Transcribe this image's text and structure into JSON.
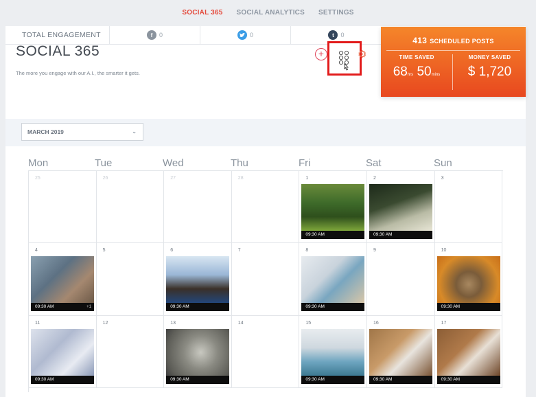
{
  "nav": {
    "items": [
      "SOCIAL 365",
      "SOCIAL ANALYTICS",
      "SETTINGS"
    ],
    "active": 0
  },
  "engagement": {
    "label": "TOTAL ENGAGEMENT",
    "facebook": "0",
    "twitter": "0",
    "tumblr": "0"
  },
  "header": {
    "title": "SOCIAL 365",
    "subtitle": "The more you engage with our A.I., the smarter it gets."
  },
  "stats": {
    "scheduled_count": "413",
    "scheduled_label": "SCHEDULED POSTS",
    "time_label": "TIME SAVED",
    "time_hrs": "68",
    "time_hrs_unit": "hrs",
    "time_mins": "50",
    "time_mins_unit": "mins",
    "money_label": "MONEY SAVED",
    "money_value": "$ 1,720"
  },
  "month_select": {
    "value": "MARCH 2019"
  },
  "calendar": {
    "weekdays": [
      "Mon",
      "Tue",
      "Wed",
      "Thu",
      "Fri",
      "Sat",
      "Sun"
    ],
    "weeks": [
      [
        {
          "day": "25",
          "other": true
        },
        {
          "day": "26",
          "other": true
        },
        {
          "day": "27",
          "other": true
        },
        {
          "day": "28",
          "other": true
        },
        {
          "day": "1",
          "time": "09:30 AM",
          "img": "forest"
        },
        {
          "day": "2",
          "time": "09:30 AM",
          "img": "grass"
        },
        {
          "day": "3"
        }
      ],
      [
        {
          "day": "4",
          "time": "09:30 AM",
          "img": "couple-bench",
          "extra": "+1",
          "strip": "orange"
        },
        {
          "day": "5"
        },
        {
          "day": "6",
          "time": "09:30 AM",
          "img": "lake-sunset"
        },
        {
          "day": "7"
        },
        {
          "day": "8",
          "time": "09:30 AM",
          "img": "books"
        },
        {
          "day": "9"
        },
        {
          "day": "10",
          "time": "09:30 AM",
          "img": "dog"
        }
      ],
      [
        {
          "day": "11",
          "time": "09:30 AM",
          "img": "desk-papers"
        },
        {
          "day": "12"
        },
        {
          "day": "13",
          "time": "09:30 AM",
          "img": "dollar"
        },
        {
          "day": "14"
        },
        {
          "day": "15",
          "time": "09:30 AM",
          "img": "hot-spring"
        },
        {
          "day": "16",
          "time": "09:30 AM",
          "img": "desk-top"
        },
        {
          "day": "17",
          "time": "09:30 AM",
          "img": "coffee"
        }
      ]
    ]
  },
  "colors": {
    "accent": "#e44a3c",
    "stats_top": "#f5862a",
    "stats_bottom": "#e8481f",
    "highlight": "#e21b1b",
    "facebook": "#8b949e",
    "twitter": "#3b9de6",
    "tumblr": "#35465c"
  }
}
